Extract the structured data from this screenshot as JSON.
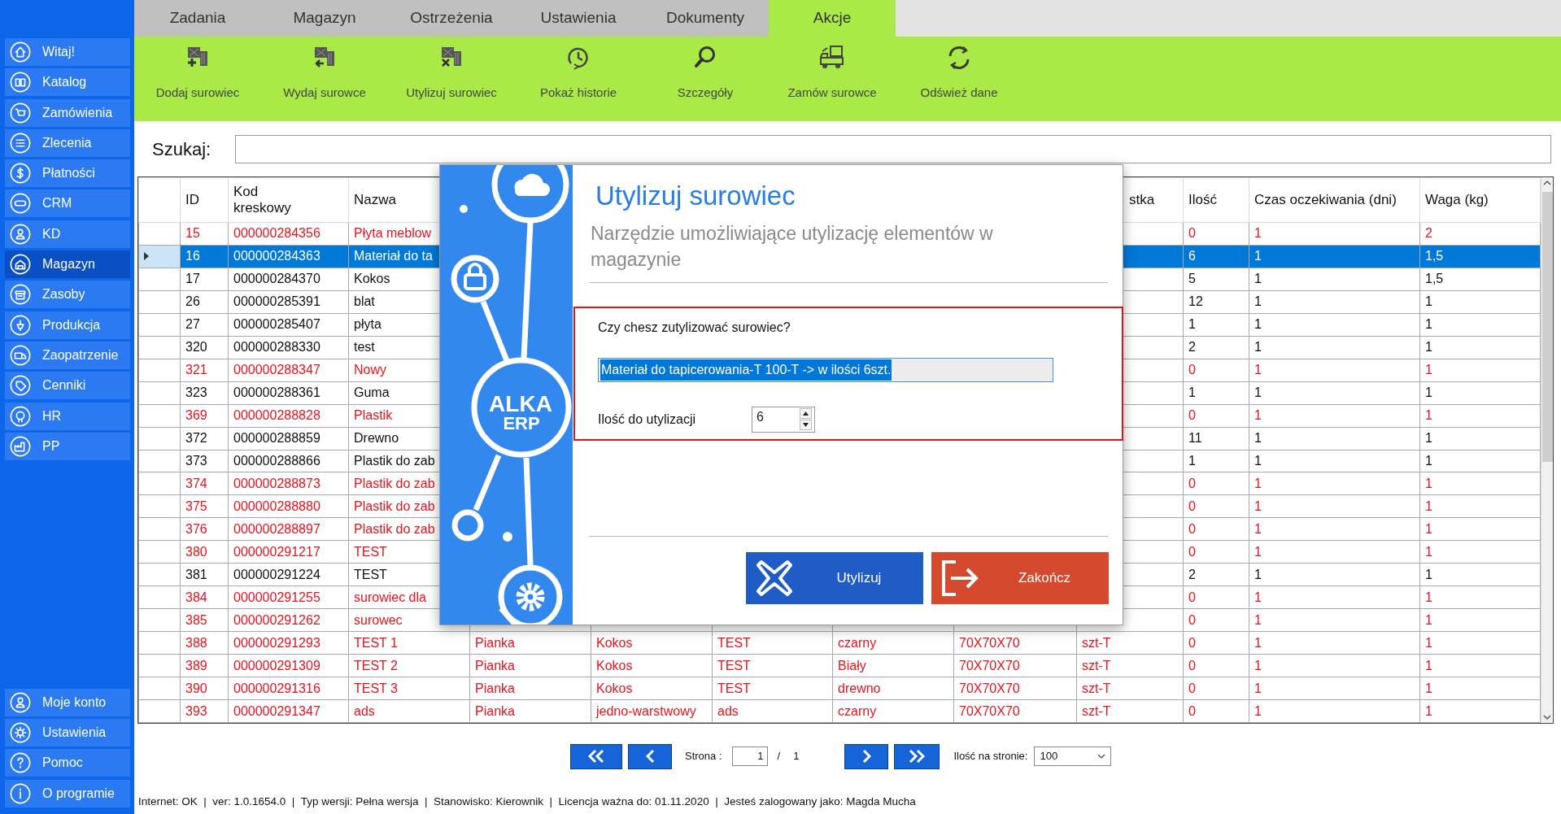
{
  "sidebar": {
    "items": [
      {
        "label": "Witaj!",
        "selected": false
      },
      {
        "label": "Katalog",
        "selected": false
      },
      {
        "label": "Zamówienia",
        "selected": false
      },
      {
        "label": "Zlecenia",
        "selected": false
      },
      {
        "label": "Płatności",
        "selected": false
      },
      {
        "label": "CRM",
        "selected": false
      },
      {
        "label": "KD",
        "selected": false
      },
      {
        "label": "Magazyn",
        "selected": true
      },
      {
        "label": "Zasoby",
        "selected": false
      },
      {
        "label": "Produkcja",
        "selected": false
      },
      {
        "label": "Zaopatrzenie",
        "selected": false
      },
      {
        "label": "Cenniki",
        "selected": false
      },
      {
        "label": "HR",
        "selected": false
      },
      {
        "label": "PP",
        "selected": false
      }
    ],
    "bottom_items": [
      {
        "label": "Moje konto",
        "selected": false
      },
      {
        "label": "Ustawienia",
        "selected": false
      },
      {
        "label": "Pomoc",
        "selected": false
      },
      {
        "label": "O programie",
        "selected": false
      }
    ]
  },
  "tabs": [
    {
      "label": "Zadania",
      "selected": false
    },
    {
      "label": "Magazyn",
      "selected": false
    },
    {
      "label": "Ostrzeżenia",
      "selected": false
    },
    {
      "label": "Ustawienia",
      "selected": false
    },
    {
      "label": "Dokumenty",
      "selected": false
    },
    {
      "label": "Akcje",
      "selected": true
    }
  ],
  "toolbar": {
    "buttons": [
      "Dodaj surowiec",
      "Wydaj surowce",
      "Utylizuj surowiec",
      "Pokaż historie",
      "Szczegóły",
      "Zamów surowce",
      "Odśwież dane"
    ]
  },
  "search": {
    "label": "Szukaj:"
  },
  "table": {
    "columns": [
      "ID",
      "Kod kreskowy",
      "Nazwa",
      "",
      "",
      "",
      "",
      "",
      "stka",
      "Ilość",
      "Czas oczekiwania (dni)",
      "Waga (kg)"
    ],
    "rows": [
      {
        "kind": "partial",
        "selected": false,
        "flagged": true,
        "cells": [
          "15",
          "000000284356",
          "Płyta meblow",
          "0",
          "1",
          "2"
        ]
      },
      {
        "kind": "partial",
        "selected": true,
        "flagged": false,
        "cells": [
          "16",
          "000000284363",
          "Materiał do ta",
          "6",
          "1",
          "1,5"
        ]
      },
      {
        "kind": "partial",
        "selected": false,
        "flagged": false,
        "cells": [
          "17",
          "000000284370",
          "Kokos",
          "5",
          "1",
          "1,5"
        ]
      },
      {
        "kind": "partial",
        "selected": false,
        "flagged": false,
        "cells": [
          "26",
          "000000285391",
          "blat",
          "12",
          "1",
          "1"
        ]
      },
      {
        "kind": "partial",
        "selected": false,
        "flagged": false,
        "cells": [
          "27",
          "000000285407",
          "płyta",
          "1",
          "1",
          "1"
        ]
      },
      {
        "kind": "partial",
        "selected": false,
        "flagged": false,
        "cells": [
          "320",
          "000000288330",
          "test",
          "2",
          "1",
          "1"
        ]
      },
      {
        "kind": "partial",
        "selected": false,
        "flagged": true,
        "cells": [
          "321",
          "000000288347",
          "Nowy",
          "0",
          "1",
          "1"
        ]
      },
      {
        "kind": "partial",
        "selected": false,
        "flagged": false,
        "cells": [
          "323",
          "000000288361",
          "Guma",
          "1",
          "1",
          "1"
        ]
      },
      {
        "kind": "partial",
        "selected": false,
        "flagged": true,
        "cells": [
          "369",
          "000000288828",
          "Plastik",
          "0",
          "1",
          "1"
        ]
      },
      {
        "kind": "partial",
        "selected": false,
        "flagged": false,
        "cells": [
          "372",
          "000000288859",
          "Drewno",
          "11",
          "1",
          "1"
        ]
      },
      {
        "kind": "partial",
        "selected": false,
        "flagged": false,
        "cells": [
          "373",
          "000000288866",
          "Plastik do zab",
          "1",
          "1",
          "1"
        ]
      },
      {
        "kind": "partial",
        "selected": false,
        "flagged": true,
        "cells": [
          "374",
          "000000288873",
          "Plastik do zab",
          "0",
          "1",
          "1"
        ]
      },
      {
        "kind": "partial",
        "selected": false,
        "flagged": true,
        "cells": [
          "375",
          "000000288880",
          "Plastik do zab",
          "0",
          "1",
          "1"
        ]
      },
      {
        "kind": "partial",
        "selected": false,
        "flagged": true,
        "cells": [
          "376",
          "000000288897",
          "Plastik do zab",
          "0",
          "1",
          "1"
        ]
      },
      {
        "kind": "partial",
        "selected": false,
        "flagged": true,
        "cells": [
          "380",
          "000000291217",
          "TEST",
          "0",
          "1",
          "1"
        ]
      },
      {
        "kind": "partial",
        "selected": false,
        "flagged": false,
        "cells": [
          "381",
          "000000291224",
          "TEST",
          "2",
          "1",
          "1"
        ]
      },
      {
        "kind": "partial",
        "selected": false,
        "flagged": true,
        "cells": [
          "384",
          "000000291255",
          "surowiec dla",
          "0",
          "1",
          "1"
        ]
      },
      {
        "kind": "partial",
        "selected": false,
        "flagged": true,
        "cells": [
          "385",
          "000000291262",
          "surowec",
          "0",
          "1",
          "1"
        ]
      },
      {
        "kind": "full",
        "selected": false,
        "flagged": true,
        "cells": [
          "388",
          "000000291293",
          "TEST 1",
          "Pianka",
          "Kokos",
          "TEST",
          "czarny",
          "70X70X70",
          "szt-T",
          "0",
          "1",
          "1"
        ]
      },
      {
        "kind": "full",
        "selected": false,
        "flagged": true,
        "cells": [
          "389",
          "000000291309",
          "TEST 2",
          "Pianka",
          "Kokos",
          "TEST",
          "Biały",
          "70X70X70",
          "szt-T",
          "0",
          "1",
          "1"
        ]
      },
      {
        "kind": "full",
        "selected": false,
        "flagged": true,
        "cells": [
          "390",
          "000000291316",
          "TEST 3",
          "Pianka",
          "Kokos",
          "TEST",
          "drewno",
          "70X70X70",
          "szt-T",
          "0",
          "1",
          "1"
        ]
      },
      {
        "kind": "full",
        "selected": false,
        "flagged": true,
        "cells": [
          "393",
          "000000291347",
          "ads",
          "Pianka",
          "jedno-warstwowy",
          "ads",
          "czarny",
          "70X70X70",
          "szt-T",
          "0",
          "1",
          "1"
        ]
      }
    ]
  },
  "dialog": {
    "logo": [
      "ALKA",
      "ERP"
    ],
    "title": "Utylizuj surowiec",
    "subtitle": "Narzędzie umożliwiające utylizację elementów w magazynie",
    "question": "Czy chesz zutylizować surowiec?",
    "summary": {
      "value": "Materiał do tapicerowania-T 100-T -> w ilości 6szt.",
      "selected": true
    },
    "quantity": {
      "label": "Ilość do utylizacji",
      "value": "6"
    },
    "buttons": [
      {
        "label": "Utylizuj",
        "kind": "confirm"
      },
      {
        "label": "Zakończ",
        "kind": "exit"
      }
    ]
  },
  "pagination": {
    "page_label": "Strona :",
    "page": "1",
    "separator": "/",
    "total": "1",
    "per_page_label": "Ilość na stronie:",
    "per_page": "100"
  },
  "status_bar": "Internet: OK  |  ver: 1.0.1654.0  |  Typ wersji: Pełna wersja  |  Stanowisko: Kierownik  |  Licencja ważna do: 01.11.2020  |  Jesteś zalogowany jako: Magda Mucha"
}
